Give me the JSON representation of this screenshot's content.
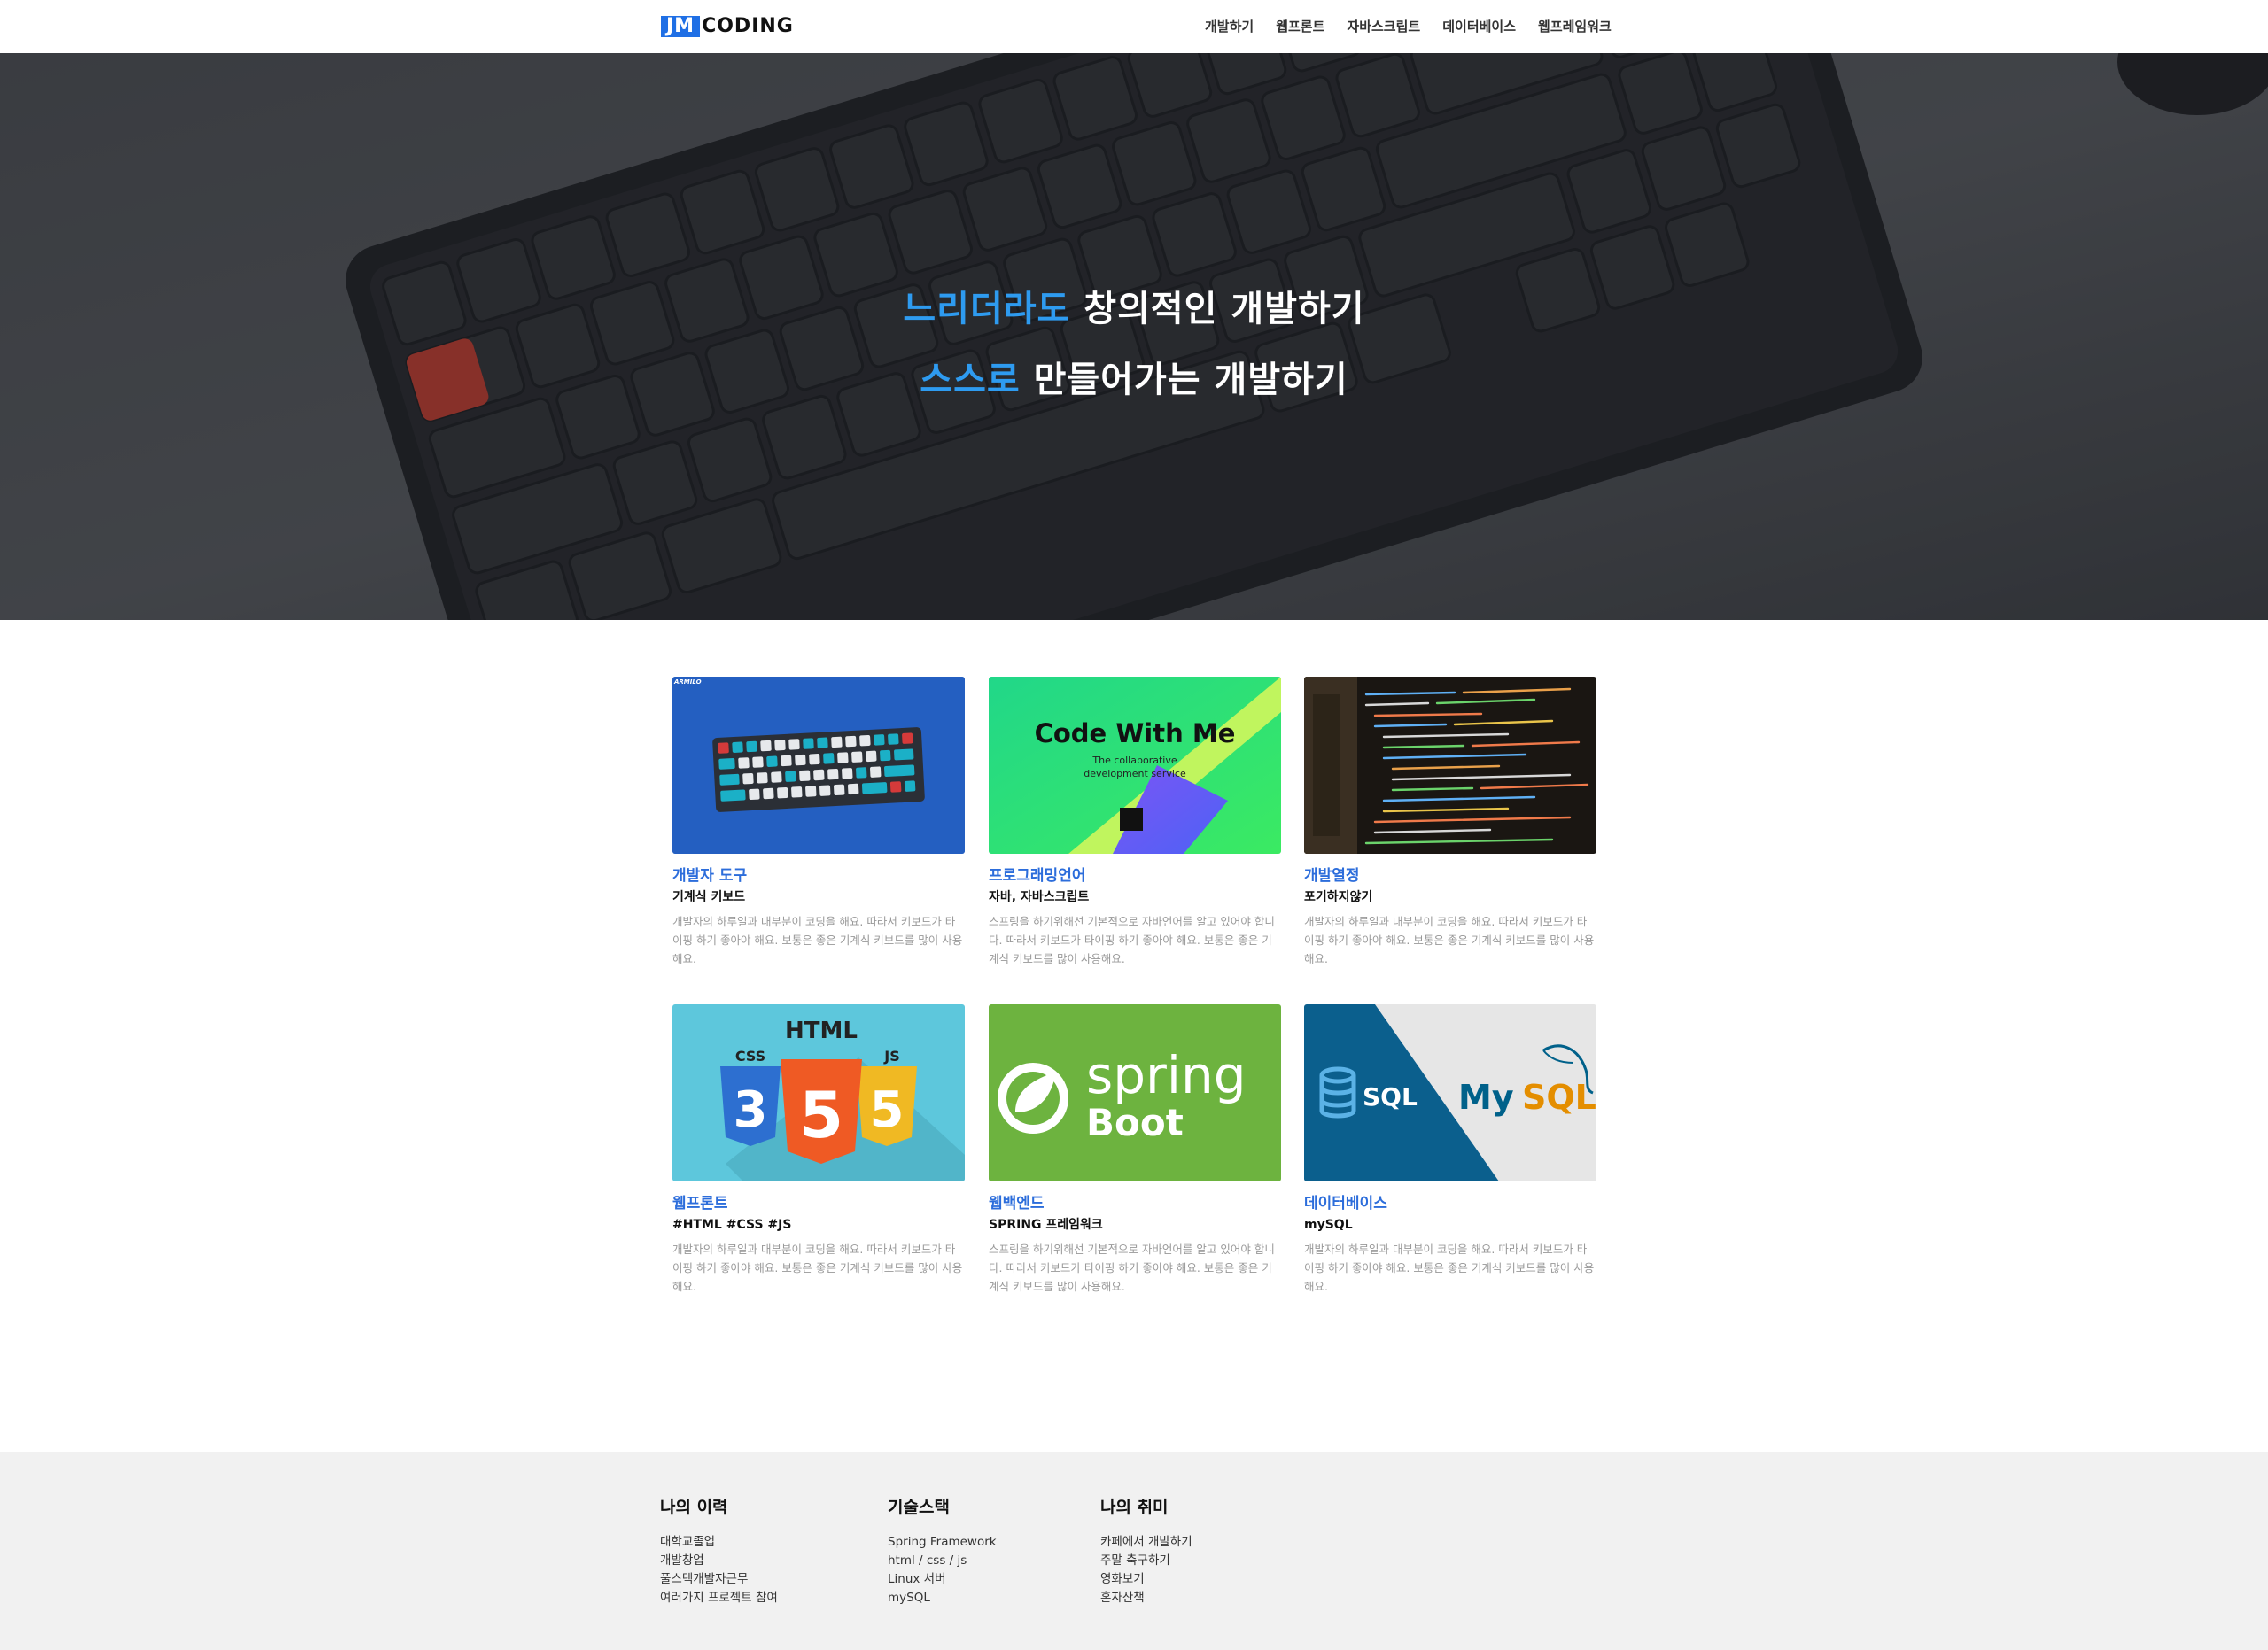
{
  "header": {
    "logo_box": "JM",
    "logo_text": "CODING",
    "nav": [
      "개발하기",
      "웹프론트",
      "자바스크립트",
      "데이터베이스",
      "웹프레임워크"
    ]
  },
  "hero": {
    "line1_accent": "느리더라도",
    "line1_rest": " 창의적인 개발하기",
    "line2_accent": "스스로",
    "line2_rest": " 만들어가는 개발하기"
  },
  "cards": [
    {
      "title": "개발자 도구",
      "sub": "기계식 키보드",
      "desc": "개발자의 하루일과 대부분이 코딩을 해요. 따라서 키보드가 타이핑 하기 좋아야 해요. 보통은 좋은 기계식 키보드를 많이 사용해요.",
      "thumb_text": "ARMILO"
    },
    {
      "title": "프로그래밍언어",
      "sub": "자바, 자바스크립트",
      "desc": "스프링을 하기위해선 기본적으로 자바언어를 알고 있어야 합니다. 따라서 키보드가 타이핑 하기 좋아야 해요. 보통은 좋은 기계식 키보드를 많이 사용해요.",
      "thumb_title": "Code With Me",
      "thumb_sub1": "The collaborative",
      "thumb_sub2": "development service"
    },
    {
      "title": "개발열정",
      "sub": "포기하지않기",
      "desc": "개발자의 하루일과 대부분이 코딩을 해요. 따라서 키보드가 타이핑 하기 좋아야 해요. 보통은 좋은 기계식 키보드를 많이 사용해요."
    },
    {
      "title": "웹프론트",
      "sub": "#HTML #CSS #JS",
      "desc": "개발자의 하루일과 대부분이 코딩을 해요. 따라서 키보드가 타이핑 하기 좋아야 해요. 보통은 좋은 기계식 키보드를 많이 사용해요.",
      "thumb_html": "HTML",
      "thumb_css": "CSS",
      "thumb_js": "JS",
      "thumb_n3": "3",
      "thumb_n5": "5",
      "thumb_n6": "5"
    },
    {
      "title": "웹백엔드",
      "sub": "SPRING 프레임워크",
      "desc": "스프링을 하기위해선 기본적으로 자바언어를 알고 있어야 합니다. 따라서 키보드가 타이핑 하기 좋아야 해요. 보통은 좋은 기계식 키보드를 많이 사용해요.",
      "thumb_spring": "spring",
      "thumb_boot": "Boot"
    },
    {
      "title": "데이터베이스",
      "sub": "mySQL",
      "desc": "개발자의 하루일과 대부분이 코딩을 해요. 따라서 키보드가 타이핑 하기 좋아야 해요. 보통은 좋은 기계식 키보드를 많이 사용해요.",
      "thumb_sql": "SQL",
      "thumb_my": "My",
      "thumb_mysql": "SQL"
    }
  ],
  "footer": {
    "columns": [
      {
        "title": "나의 이력",
        "items": [
          "대학교졸업",
          "개발창업",
          "풀스텍개발자근무",
          "여러가지 프로젝트 참여"
        ]
      },
      {
        "title": "기술스택",
        "items": [
          "Spring Framework",
          "html / css / js",
          "Linux 서버",
          "mySQL"
        ]
      },
      {
        "title": "나의 취미",
        "items": [
          "카페에서 개발하기",
          "주말 축구하기",
          "영화보기",
          "혼자산책"
        ]
      }
    ]
  },
  "colors": {
    "accent_blue": "#2e9bf0",
    "card_title_blue": "#2c6ddb",
    "logo_blue": "#1f6fe5",
    "footer_bg": "#f1f1f1"
  }
}
